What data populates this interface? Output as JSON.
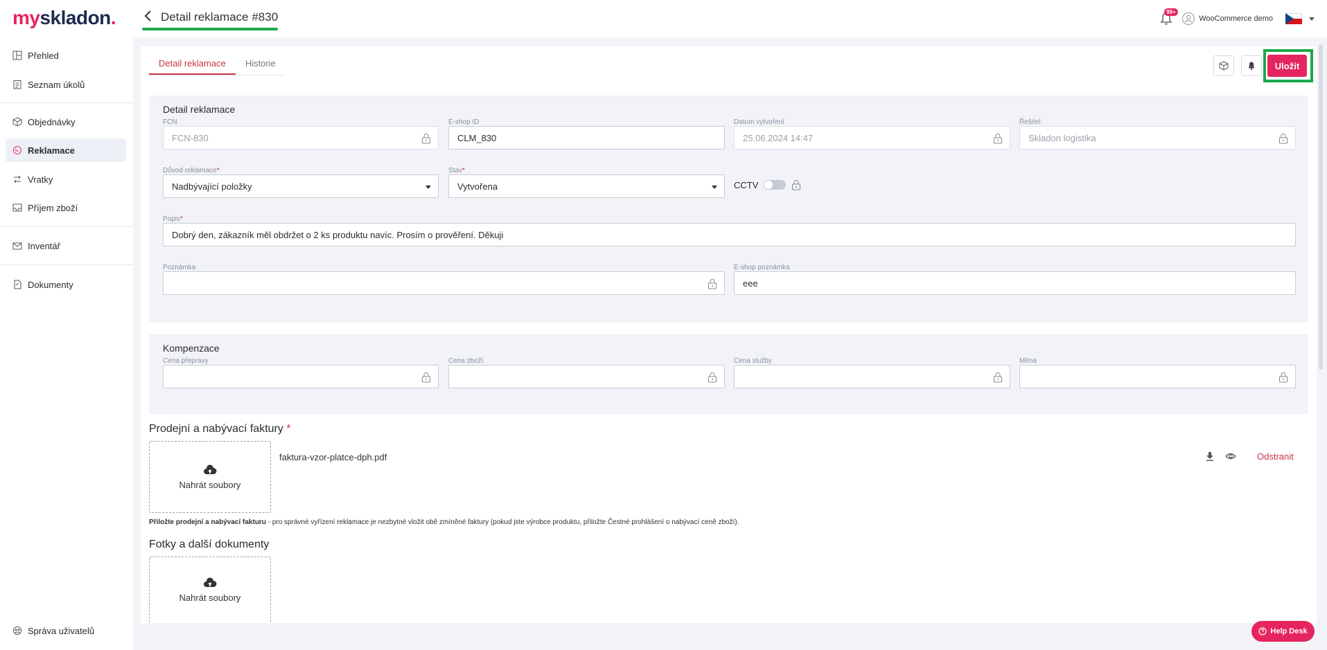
{
  "brand": {
    "logo_part1": "my",
    "logo_part2": "skladon",
    "logo_dot": ".",
    "accent": "#e6245e",
    "highlight": "#1ea84a"
  },
  "header": {
    "title": "Detail reklamace #830",
    "notif_count": "99+",
    "user_name": "WooCommerce demo",
    "language_flag": "cz-flag-icon"
  },
  "sidebar": {
    "items": [
      {
        "label": "Přehled",
        "icon": "grid-icon"
      },
      {
        "label": "Seznam úkolů",
        "icon": "clipboard-icon"
      },
      {
        "label": "Objednávky",
        "icon": "box-icon"
      },
      {
        "label": "Reklamace",
        "icon": "return-icon",
        "active": true
      },
      {
        "label": "Vratky",
        "icon": "exchange-icon"
      },
      {
        "label": "Příjem zboží",
        "icon": "inbox-icon"
      },
      {
        "label": "Inventář",
        "icon": "mail-icon"
      },
      {
        "label": "Dokumenty",
        "icon": "document-icon"
      }
    ],
    "footer": "Správa uživatelů"
  },
  "tabs": [
    "Detail reklamace",
    "Historie"
  ],
  "actions": {
    "save": "Uložit"
  },
  "detail": {
    "title": "Detail reklamace",
    "fcn": {
      "label": "FCN",
      "value": "FCN-830"
    },
    "eshop_id": {
      "label": "E-shop ID",
      "value": "CLM_830"
    },
    "created": {
      "label": "Datum vytvoření",
      "value": "25.06.2024 14:47"
    },
    "resolver": {
      "label": "Řešitel",
      "value": "Skladon logistika"
    },
    "reason": {
      "label": "Důvod reklamace",
      "value": "Nadbývající položky"
    },
    "state": {
      "label": "Stav",
      "value": "Vytvořena"
    },
    "cctv": "CCTV",
    "description": {
      "label": "Popis",
      "value": "Dobrý den, zákazník měl obdržet o 2 ks produktu navíc. Prosím o prověření. Děkuji"
    },
    "note": {
      "label": "Poznámka",
      "value": ""
    },
    "eshop_note": {
      "label": "E-shop poznámka",
      "value": "eee"
    }
  },
  "compensation": {
    "title": "Kompenzace",
    "shipping": {
      "label": "Cena přepravy",
      "value": ""
    },
    "goods": {
      "label": "Cena zboží",
      "value": ""
    },
    "service": {
      "label": "Cena služby",
      "value": ""
    },
    "currency": {
      "label": "Měna",
      "value": ""
    }
  },
  "invoices": {
    "title": "Prodejní a nabývací faktury",
    "required_mark": "*",
    "upload": "Nahrát soubory",
    "file": "faktura-vzor-platce-dph.pdf",
    "remove": "Odstranit",
    "hint_bold": "Přiložte prodejní a nabývací fakturu",
    "hint_rest": " - pro správné vyřízení reklamace je nezbytné vložit obě zmíněné faktury (pokud jste výrobce produktu, přiložte Čestné prohlášení o nabývací ceně zboží)."
  },
  "photos": {
    "title": "Fotky a další dokumenty",
    "upload": "Nahrát soubory"
  },
  "helpdesk": "Help Desk",
  "req_mark": "*"
}
